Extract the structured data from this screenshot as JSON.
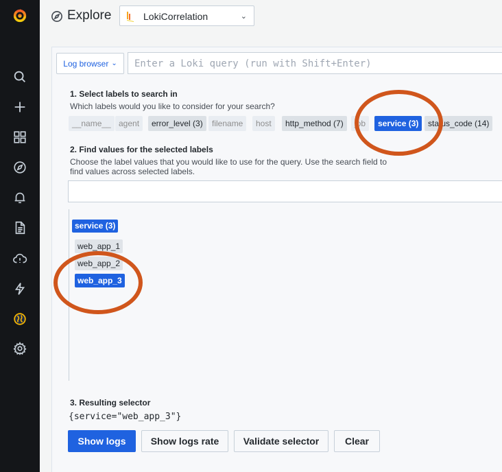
{
  "header": {
    "title": "Explore",
    "datasource": "LokiCorrelation"
  },
  "query": {
    "log_browser_label": "Log browser",
    "placeholder": "Enter a Loki query (run with Shift+Enter)"
  },
  "step1": {
    "title": "1. Select labels to search in",
    "description": "Which labels would you like to consider for your search?",
    "labels": [
      "__name__",
      "agent",
      "error_level (3)",
      "filename",
      "host",
      "http_method (7)",
      "job",
      "service (3)",
      "status_code (14)"
    ]
  },
  "step2": {
    "title": "2. Find values for the selected labels",
    "description_line1": "Choose the label values that you would like to use for the query. Use the search field to",
    "description_line2": "find values across selected labels.",
    "group_label": "service (3)",
    "values": [
      "web_app_1",
      "web_app_2",
      "web_app_3"
    ],
    "selected_value": "web_app_3"
  },
  "step3": {
    "title": "3. Resulting selector",
    "selector": "{service=\"web_app_3\"}"
  },
  "buttons": {
    "show_logs": "Show logs",
    "show_logs_rate": "Show logs rate",
    "validate": "Validate selector",
    "clear": "Clear"
  },
  "colors": {
    "accent": "#1f62e0",
    "annotation": "#d0561c",
    "sidebar": "#141619"
  },
  "sidebar_icons": [
    "grafana-logo-icon",
    "search-icon",
    "plus-icon",
    "dashboards-icon",
    "explore-compass-icon",
    "alerting-bell-icon",
    "document-icon",
    "cloud-alert-icon",
    "lightning-icon",
    "globe-icon",
    "gear-icon"
  ]
}
